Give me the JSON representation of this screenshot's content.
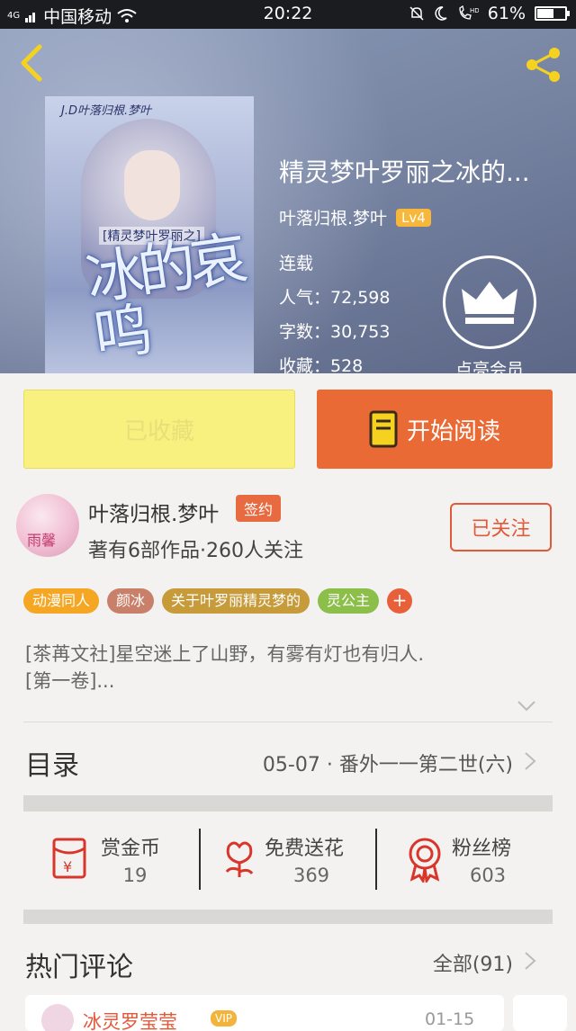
{
  "status_bar": {
    "signal_text": "4G",
    "carrier": "中国移动",
    "time": "20:22",
    "battery": "61%",
    "battery_level": 0.61,
    "icons": [
      "wifi-icon",
      "mute-icon",
      "moon-icon",
      "hd-call-icon",
      "battery-icon"
    ]
  },
  "header": {
    "back_icon": "chevron-left-icon",
    "share_icon": "share-icon",
    "accent_color": "#f5d21f"
  },
  "book": {
    "title": "精灵梦叶罗丽之冰的...",
    "cover": {
      "author_tag": "J.D叶落归根.梦叶",
      "subtitle": "[精灵梦叶罗丽之]",
      "big_title": "冰的哀鸣"
    },
    "author": "叶落归根.梦叶",
    "level": "Lv4",
    "status": "连载",
    "popularity_label": "人气：72,598",
    "word_count_label": "字数：30,753",
    "favorites_label": "收藏：528",
    "vip_label": "点亮会员"
  },
  "actions": {
    "collected_label": "已收藏",
    "read_label": "开始阅读",
    "read_color": "#ea6a35"
  },
  "author_card": {
    "avatar_text": "雨馨",
    "name": "叶落归根.梦叶",
    "badge": "签约",
    "meta": "著有6部作品·260人关注",
    "follow_label": "已关注"
  },
  "tags": [
    {
      "label": "动漫同人",
      "color": "#f5a623"
    },
    {
      "label": "颜冰",
      "color": "#c9806a"
    },
    {
      "label": "关于叶罗丽精灵梦的",
      "color": "#c79a3a"
    },
    {
      "label": "灵公主",
      "color": "#8bbf4a"
    }
  ],
  "tag_add": "+",
  "description": "[茶苒文社]星空迷上了山野，有雾有灯也有归人.\n[第一卷]...",
  "toc": {
    "label": "目录",
    "latest": "05-07 · 番外一一第二世(六)"
  },
  "rewards": [
    {
      "label": "赏金币",
      "value": "19",
      "icon": "red-envelope-yuan-icon"
    },
    {
      "label": "免费送花",
      "value": "369",
      "icon": "flower-icon"
    },
    {
      "label": "粉丝榜",
      "value": "603",
      "icon": "medal-icon"
    }
  ],
  "comments": {
    "label": "热门评论",
    "all_label": "全部(91)",
    "first": {
      "user": "冰灵罗莹莹",
      "badge": "VIP",
      "date": "01-15"
    }
  }
}
